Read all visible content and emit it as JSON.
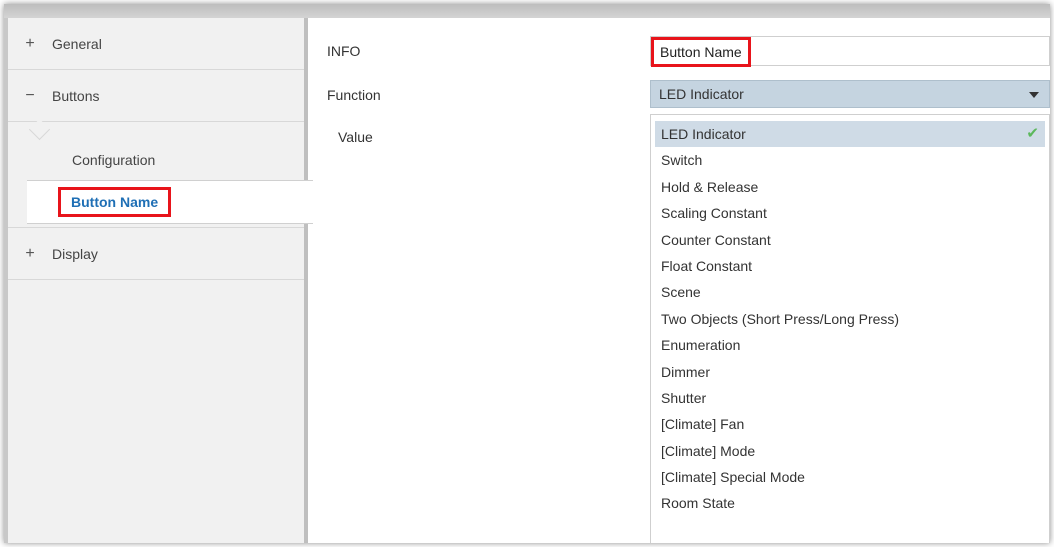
{
  "sidebar": {
    "items": [
      {
        "sign": "+",
        "label": "General"
      },
      {
        "sign": "−",
        "label": "Buttons"
      },
      {
        "sign": "+",
        "label": "Display"
      }
    ],
    "sub_items": [
      {
        "label": "Configuration"
      },
      {
        "label": "Button Name",
        "selected": true
      }
    ]
  },
  "params": {
    "info_label": "INFO",
    "info_value": "Button Name",
    "function_label": "Function",
    "function_value": "LED Indicator",
    "value_label": "Value"
  },
  "dropdown": {
    "options": [
      "LED Indicator",
      "Switch",
      "Hold & Release",
      "Scaling Constant",
      "Counter Constant",
      "Float Constant",
      "Scene",
      "Two Objects (Short Press/Long Press)",
      "Enumeration",
      "Dimmer",
      "Shutter",
      "[Climate] Fan",
      "[Climate] Mode",
      "[Climate] Special Mode",
      "Room State"
    ],
    "selected_index": 0,
    "check_icon": "check-icon"
  },
  "colors": {
    "highlight_red": "#e8141b",
    "selected_text_blue": "#1f6fb5",
    "select_bg": "#c5d4e0",
    "check_green": "#5cb85c"
  }
}
